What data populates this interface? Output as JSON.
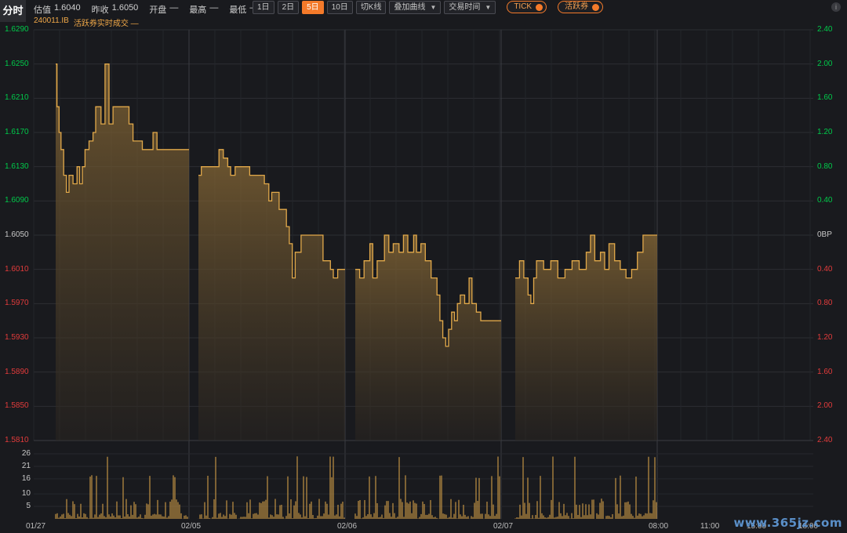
{
  "header": {
    "tab_title": "分时",
    "stats": [
      {
        "label": "估值",
        "value": "1.6040"
      },
      {
        "label": "昨收",
        "value": "1.6050"
      },
      {
        "label": "开盘",
        "value": "—"
      },
      {
        "label": "最高",
        "value": "—"
      },
      {
        "label": "最低",
        "value": "—"
      }
    ],
    "period_buttons": [
      "1日",
      "2日",
      "5日",
      "10日"
    ],
    "active_period": "5日",
    "kline_button": "切K线",
    "overlay_dropdown": "叠加曲线",
    "time_dropdown": "交易时间",
    "tick_toggle": "TICK",
    "active_bond_toggle": "活跃券",
    "subtitle_code": "240011.IB",
    "subtitle_series": "活跃券实时成交 —"
  },
  "colors": {
    "background": "#191a1e",
    "up": "#00c94a",
    "down": "#e23b3b",
    "line": "#e2a94a",
    "accent": "#f47a2a"
  },
  "chart_data": {
    "type": "line",
    "price_ticks": [
      "1.6290",
      "1.6250",
      "1.6210",
      "1.6170",
      "1.6130",
      "1.6090",
      "1.6050",
      "1.6010",
      "1.5970",
      "1.5930",
      "1.5890",
      "1.5850",
      "1.5810"
    ],
    "pct_ticks": [
      "2.40",
      "2.00",
      "1.60",
      "1.20",
      "0.80",
      "0.40",
      "0BP",
      "0.40",
      "0.80",
      "1.20",
      "1.60",
      "2.00",
      "2.40"
    ],
    "ylim": [
      1.581,
      1.629
    ],
    "prev_close": 1.605,
    "volume_ticks": [
      "26",
      "21",
      "16",
      "10",
      "5"
    ],
    "volume_max": 26,
    "x_labels": [
      "01/27",
      "02/05",
      "02/06",
      "02/07",
      "08:00",
      "11:00",
      "15:00",
      "18:00"
    ],
    "days": [
      {
        "points": [
          [
            0,
            1.625
          ],
          [
            0.01,
            1.62
          ],
          [
            0.025,
            1.617
          ],
          [
            0.04,
            1.615
          ],
          [
            0.06,
            1.612
          ],
          [
            0.08,
            1.61
          ],
          [
            0.1,
            1.612
          ],
          [
            0.13,
            1.611
          ],
          [
            0.16,
            1.613
          ],
          [
            0.18,
            1.611
          ],
          [
            0.2,
            1.613
          ],
          [
            0.22,
            1.615
          ],
          [
            0.25,
            1.616
          ],
          [
            0.28,
            1.617
          ],
          [
            0.3,
            1.62
          ],
          [
            0.34,
            1.618
          ],
          [
            0.37,
            1.625
          ],
          [
            0.4,
            1.618
          ],
          [
            0.43,
            1.62
          ],
          [
            0.5,
            1.62
          ],
          [
            0.55,
            1.618
          ],
          [
            0.58,
            1.616
          ],
          [
            0.62,
            1.616
          ],
          [
            0.65,
            1.615
          ],
          [
            0.7,
            1.615
          ],
          [
            0.73,
            1.617
          ],
          [
            0.76,
            1.615
          ],
          [
            0.8,
            1.615
          ],
          [
            0.9,
            1.615
          ],
          [
            1,
            1.615
          ]
        ]
      },
      {
        "points": [
          [
            0,
            1.612
          ],
          [
            0.02,
            1.613
          ],
          [
            0.1,
            1.613
          ],
          [
            0.14,
            1.615
          ],
          [
            0.17,
            1.614
          ],
          [
            0.2,
            1.613
          ],
          [
            0.22,
            1.612
          ],
          [
            0.25,
            1.613
          ],
          [
            0.3,
            1.613
          ],
          [
            0.35,
            1.612
          ],
          [
            0.4,
            1.612
          ],
          [
            0.45,
            1.611
          ],
          [
            0.48,
            1.609
          ],
          [
            0.5,
            1.61
          ],
          [
            0.55,
            1.608
          ],
          [
            0.6,
            1.606
          ],
          [
            0.62,
            1.604
          ],
          [
            0.64,
            1.6
          ],
          [
            0.66,
            1.603
          ],
          [
            0.7,
            1.605
          ],
          [
            0.8,
            1.605
          ],
          [
            0.85,
            1.602
          ],
          [
            0.9,
            1.601
          ],
          [
            0.92,
            1.6
          ],
          [
            0.95,
            1.601
          ],
          [
            1,
            1.601
          ]
        ]
      },
      {
        "points": [
          [
            0,
            1.601
          ],
          [
            0.03,
            1.6
          ],
          [
            0.06,
            1.602
          ],
          [
            0.1,
            1.604
          ],
          [
            0.12,
            1.6
          ],
          [
            0.15,
            1.602
          ],
          [
            0.2,
            1.605
          ],
          [
            0.23,
            1.603
          ],
          [
            0.26,
            1.604
          ],
          [
            0.3,
            1.603
          ],
          [
            0.33,
            1.605
          ],
          [
            0.36,
            1.603
          ],
          [
            0.4,
            1.605
          ],
          [
            0.42,
            1.603
          ],
          [
            0.45,
            1.604
          ],
          [
            0.48,
            1.602
          ],
          [
            0.5,
            1.602
          ],
          [
            0.52,
            1.6
          ],
          [
            0.56,
            1.598
          ],
          [
            0.58,
            1.595
          ],
          [
            0.6,
            1.593
          ],
          [
            0.62,
            1.592
          ],
          [
            0.64,
            1.594
          ],
          [
            0.66,
            1.596
          ],
          [
            0.68,
            1.595
          ],
          [
            0.7,
            1.597
          ],
          [
            0.72,
            1.598
          ],
          [
            0.75,
            1.597
          ],
          [
            0.78,
            1.6
          ],
          [
            0.8,
            1.597
          ],
          [
            0.83,
            1.596
          ],
          [
            0.86,
            1.595
          ],
          [
            0.9,
            1.595
          ],
          [
            1,
            1.595
          ]
        ]
      },
      {
        "points": [
          [
            0,
            1.6
          ],
          [
            0.03,
            1.602
          ],
          [
            0.06,
            1.6
          ],
          [
            0.09,
            1.598
          ],
          [
            0.11,
            1.597
          ],
          [
            0.13,
            1.6
          ],
          [
            0.15,
            1.602
          ],
          [
            0.2,
            1.601
          ],
          [
            0.25,
            1.602
          ],
          [
            0.3,
            1.6
          ],
          [
            0.35,
            1.601
          ],
          [
            0.4,
            1.602
          ],
          [
            0.45,
            1.601
          ],
          [
            0.5,
            1.603
          ],
          [
            0.53,
            1.605
          ],
          [
            0.56,
            1.602
          ],
          [
            0.6,
            1.603
          ],
          [
            0.63,
            1.601
          ],
          [
            0.66,
            1.604
          ],
          [
            0.7,
            1.602
          ],
          [
            0.74,
            1.601
          ],
          [
            0.78,
            1.6
          ],
          [
            0.82,
            1.601
          ],
          [
            0.86,
            1.603
          ],
          [
            0.9,
            1.605
          ],
          [
            1,
            1.605
          ]
        ]
      }
    ]
  },
  "watermark": "www.365jz.com"
}
